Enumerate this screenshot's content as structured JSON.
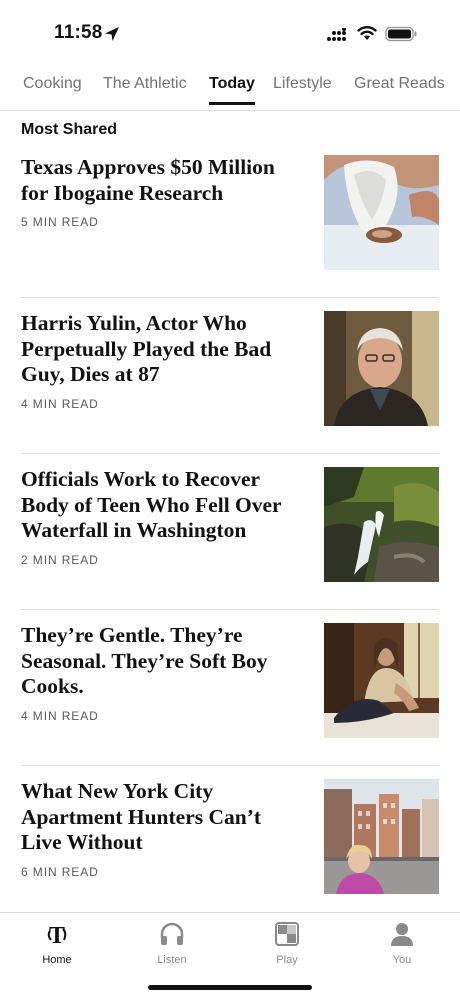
{
  "status_bar": {
    "time": "11:58"
  },
  "tabs": [
    {
      "label": "Cooking",
      "active": false
    },
    {
      "label": "The Athletic",
      "active": false
    },
    {
      "label": "Today",
      "active": true
    },
    {
      "label": "Lifestyle",
      "active": false
    },
    {
      "label": "Great Reads",
      "active": false
    }
  ],
  "section": {
    "title": "Most Shared"
  },
  "articles": [
    {
      "headline": "Texas Approves $50 Million for Ibogaine Research",
      "meta": "5 MIN READ",
      "image": "hands-powder-photo"
    },
    {
      "headline": "Harris Yulin, Actor Who Perpetually Played the Bad Guy, Dies at 87",
      "meta": "4 MIN READ",
      "image": "portrait-photo"
    },
    {
      "headline": "Officials Work to Recover Body of Teen Who Fell Over Waterfall in Washington",
      "meta": "2 MIN READ",
      "image": "waterfall-photo"
    },
    {
      "headline": "They’re Gentle. They’re Seasonal. They’re Soft Boy Cooks.",
      "meta": "4 MIN READ",
      "image": "man-sitting-photo"
    },
    {
      "headline": "What New York City Apartment Hunters Can’t Live Without",
      "meta": "6 MIN READ",
      "image": "rooftop-woman-photo"
    }
  ],
  "bottom_nav": [
    {
      "label": "Home",
      "icon": "nyt-logo-icon",
      "active": true
    },
    {
      "label": "Listen",
      "icon": "headphones-icon",
      "active": false
    },
    {
      "label": "Play",
      "icon": "games-grid-icon",
      "active": false
    },
    {
      "label": "You",
      "icon": "person-icon",
      "active": false
    }
  ],
  "colors": {
    "text": "#121212",
    "muted": "#727272",
    "divider": "#dcdcdc"
  }
}
